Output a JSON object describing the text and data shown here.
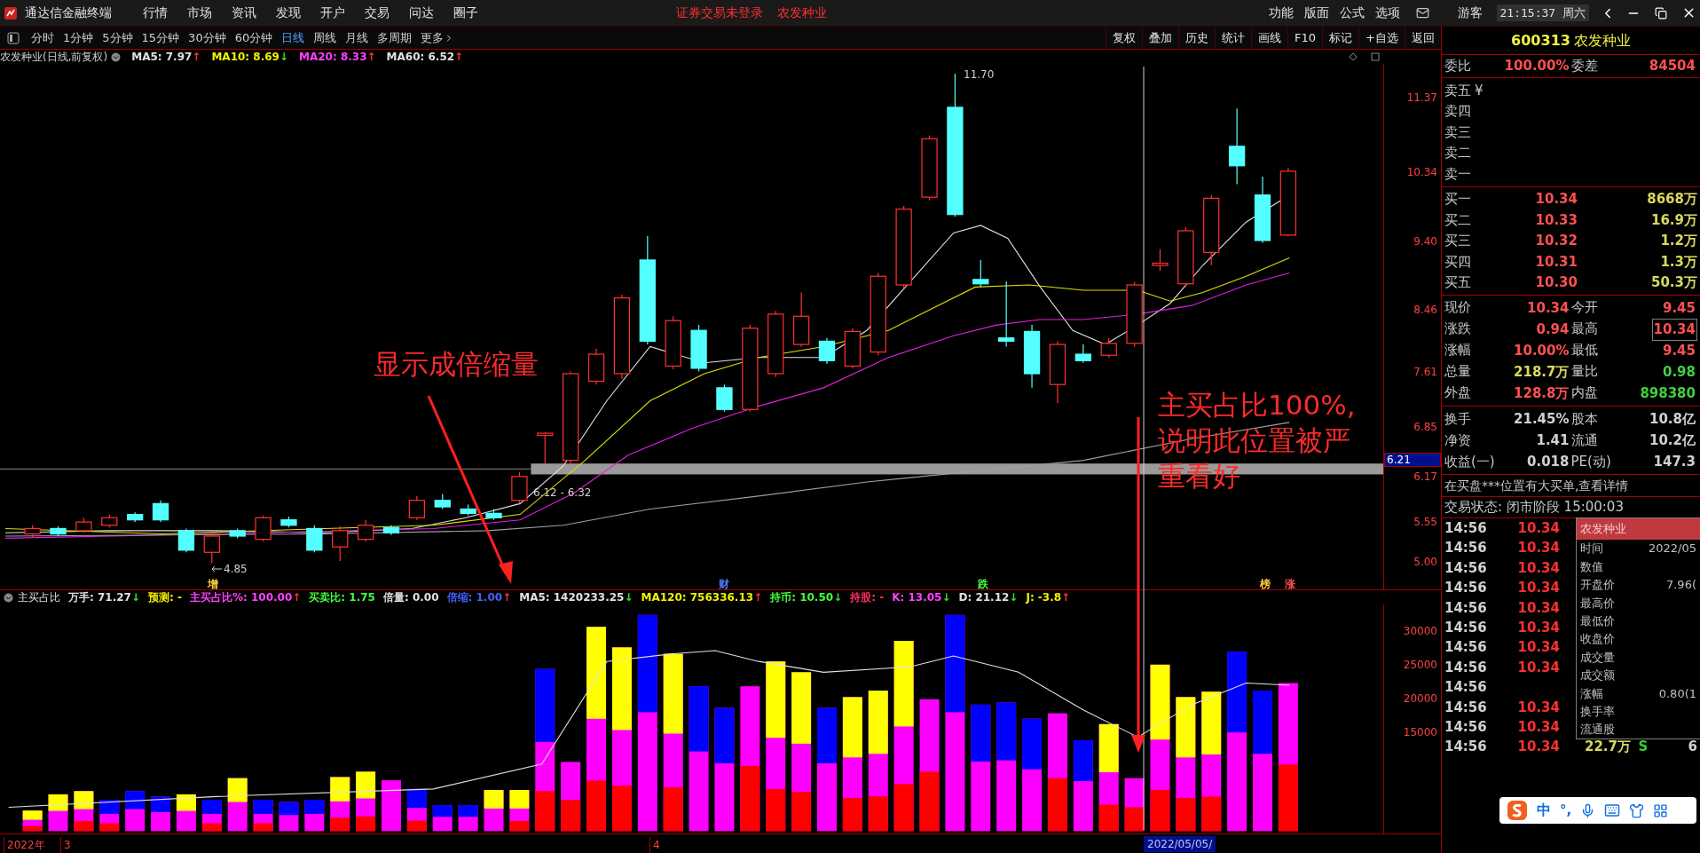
{
  "title_bar": {
    "app_name": "通达信金融终端",
    "menu": [
      "行情",
      "市场",
      "资讯",
      "发现",
      "开户",
      "交易",
      "问达",
      "圈子"
    ],
    "notices": [
      "证券交易未登录",
      "农发种业"
    ],
    "right_menu": [
      "功能",
      "版面",
      "公式",
      "选项"
    ],
    "user": "游客",
    "clock": "21:15:37 周六"
  },
  "period_bar": {
    "periods": [
      {
        "label": "分时",
        "selected": false
      },
      {
        "label": "1分钟",
        "selected": false
      },
      {
        "label": "5分钟",
        "selected": false
      },
      {
        "label": "15分钟",
        "selected": false
      },
      {
        "label": "30分钟",
        "selected": false
      },
      {
        "label": "60分钟",
        "selected": false
      },
      {
        "label": "日线",
        "selected": true
      },
      {
        "label": "周线",
        "selected": false
      },
      {
        "label": "月线",
        "selected": false
      },
      {
        "label": "多周期",
        "selected": false
      },
      {
        "label": "更多",
        "selected": false
      }
    ],
    "tools": [
      "复权",
      "叠加",
      "历史",
      "统计",
      "画线",
      "F10",
      "标记",
      "+自选",
      "返回"
    ]
  },
  "chart": {
    "title": "农发种业(日线,前复权)",
    "ma": [
      {
        "label": "MA5: 7.97",
        "color": "#e0e0e0",
        "arrow": {
          "text": "↑",
          "color": "#ff3030"
        }
      },
      {
        "label": "MA10: 8.69",
        "color": "#f0f000",
        "arrow": {
          "text": "↓",
          "color": "#30e030"
        }
      },
      {
        "label": "MA20: 8.33",
        "color": "#ff40ff",
        "arrow": {
          "text": "↑",
          "color": "#ff3030"
        }
      },
      {
        "label": "MA60: 6.52",
        "color": "#e0e0e0",
        "arrow": {
          "text": "↑",
          "color": "#ff3030"
        }
      }
    ],
    "price_ticks": [
      "11.37",
      "10.34",
      "9.40",
      "8.46",
      "7.61",
      "6.85",
      "6.17",
      "5.55",
      "5.00"
    ],
    "high_label": "11.70",
    "low_label": "4.85",
    "band_label": "6.12 - 6.32",
    "cursor_price": "6.21",
    "event_marks": [
      {
        "text": "增",
        "color": "#ffd040"
      },
      {
        "text": "财",
        "color": "#5080ff"
      },
      {
        "text": "跌",
        "color": "#40ff40"
      },
      {
        "text": "榜",
        "color": "#ffd040"
      },
      {
        "text": "涨",
        "color": "#ff5050"
      }
    ],
    "annotations": [
      {
        "lines": [
          "显示成倍缩量"
        ]
      },
      {
        "lines": [
          "主买占比100%,",
          "说明此位置被严",
          "重看好"
        ]
      }
    ]
  },
  "indicator": {
    "name": "主买占比",
    "items": [
      {
        "label": "万手: 71.27",
        "color": "#e0e0e0",
        "arrow": {
          "text": "↓",
          "color": "#30e030"
        }
      },
      {
        "label": "预测: -",
        "color": "#f0f000"
      },
      {
        "label": "主买占比%: 100.00",
        "color": "#ff40ff",
        "arrow": {
          "text": "↑",
          "color": "#ff3030"
        }
      },
      {
        "label": "买卖比: 1.75",
        "color": "#40ff40"
      },
      {
        "label": "倍量: 0.00",
        "color": "#e0e0e0"
      },
      {
        "label": "倍缩: 1.00",
        "color": "#4060ff",
        "arrow": {
          "text": "↑",
          "color": "#ff3030"
        }
      },
      {
        "label": "MA5: 1420233.25",
        "color": "#e0e0e0",
        "arrow": {
          "text": "↓",
          "color": "#30e030"
        }
      },
      {
        "label": "MA120: 756336.13",
        "color": "#f0f000",
        "arrow": {
          "text": "↑",
          "color": "#ff3030"
        }
      },
      {
        "label": "持币: 10.50",
        "color": "#40ff40",
        "arrow": {
          "text": "↓",
          "color": "#30e030"
        }
      },
      {
        "label": "持股: -",
        "color": "#ff3060"
      },
      {
        "label": "K: 13.05",
        "color": "#ff40ff",
        "arrow": {
          "text": "↓",
          "color": "#30e030"
        }
      },
      {
        "label": "D: 21.12",
        "color": "#e0e0e0",
        "arrow": {
          "text": "↓",
          "color": "#30e030"
        }
      },
      {
        "label": "J: -3.8",
        "color": "#f0f000",
        "arrow": {
          "text": "↑",
          "color": "#ff3030"
        }
      }
    ],
    "volume_ticks": [
      "30000",
      "25000",
      "20000",
      "15000"
    ]
  },
  "date_axis": {
    "labels": [
      "2022年",
      "3",
      "4"
    ],
    "cursor_date": "2022/05/05/"
  },
  "quote_panel": {
    "code": "600313",
    "name": "农发种业",
    "order_ratio": [
      {
        "label": "委比",
        "value": "100.00%"
      },
      {
        "label": "委差",
        "value": "84504"
      }
    ],
    "asks": [
      "卖五",
      "卖四",
      "卖三",
      "卖二",
      "卖一"
    ],
    "ask_symbol": "¥",
    "bids": [
      {
        "label": "买一",
        "price": "10.34",
        "volume": "8668万"
      },
      {
        "label": "买二",
        "price": "10.33",
        "volume": "16.9万"
      },
      {
        "label": "买三",
        "price": "10.32",
        "volume": "1.2万"
      },
      {
        "label": "买四",
        "price": "10.31",
        "volume": "1.3万"
      },
      {
        "label": "买五",
        "price": "10.30",
        "volume": "50.3万"
      }
    ],
    "stats": [
      [
        {
          "label": "现价",
          "value": "10.34",
          "color": "#ff5050",
          "boxed": false
        },
        {
          "label": "今开",
          "value": "9.45",
          "color": "#ff5050",
          "boxed": false
        }
      ],
      [
        {
          "label": "涨跌",
          "value": "0.94",
          "color": "#ff5050",
          "boxed": false
        },
        {
          "label": "最高",
          "value": "10.34",
          "color": "#ff5050",
          "boxed": true
        }
      ],
      [
        {
          "label": "涨幅",
          "value": "10.00%",
          "color": "#ff5050",
          "boxed": false
        },
        {
          "label": "最低",
          "value": "9.45",
          "color": "#ff5050",
          "boxed": false
        }
      ],
      [
        {
          "label": "总量",
          "value": "218.7万",
          "color": "#d8d860",
          "boxed": false
        },
        {
          "label": "量比",
          "value": "0.98",
          "color": "#40d040",
          "boxed": false
        }
      ],
      [
        {
          "label": "外盘",
          "value": "128.8万",
          "color": "#ff5050",
          "boxed": false
        },
        {
          "label": "内盘",
          "value": "898380",
          "color": "#40d040",
          "boxed": false
        }
      ]
    ],
    "finance": [
      [
        {
          "label": "换手",
          "value": "21.45%"
        },
        {
          "label": "股本",
          "value": "10.8亿"
        }
      ],
      [
        {
          "label": "净资",
          "value": "1.41"
        },
        {
          "label": "流通",
          "value": "10.2亿"
        }
      ],
      [
        {
          "label": "收益(一)",
          "value": "0.018"
        },
        {
          "label": "PE(动)",
          "value": "147.3"
        }
      ]
    ],
    "message": "在买盘***位置有大买单,查看详情",
    "trade_status": "交易状态: 闭市阶段 15:00:03",
    "ticks": [
      {
        "time": "14:56",
        "price": "10.34"
      },
      {
        "time": "14:56",
        "price": "10.34"
      },
      {
        "time": "14:56",
        "price": "10.34"
      },
      {
        "time": "14:56",
        "price": "10.34"
      },
      {
        "time": "14:56",
        "price": "10.34"
      },
      {
        "time": "14:56",
        "price": "10.34"
      },
      {
        "time": "14:56",
        "price": "10.34"
      },
      {
        "time": "14:56",
        "price": "10.34"
      },
      {
        "time": "14:56"
      },
      {
        "time": "14:56",
        "price": "10.34"
      },
      {
        "time": "14:56",
        "price": "10.34"
      },
      {
        "time": "14:56",
        "price": "10.34",
        "volume": "22.7万",
        "side": "S",
        "count": "6"
      }
    ]
  },
  "popup": {
    "title": "农发种业",
    "rows": [
      {
        "label": "时间",
        "value": "2022/05"
      },
      {
        "label": "数值"
      },
      {
        "label": "开盘价",
        "value": "7.96("
      },
      {
        "label": "最高价"
      },
      {
        "label": "最低价"
      },
      {
        "label": "收盘价"
      },
      {
        "label": "成交量"
      },
      {
        "label": "成交额"
      },
      {
        "label": "涨幅",
        "value": "0.80(1"
      },
      {
        "label": "换手率"
      },
      {
        "label": "流通股"
      }
    ]
  },
  "ime_bar": {
    "mode": "中",
    "punctuation": "°,"
  }
}
